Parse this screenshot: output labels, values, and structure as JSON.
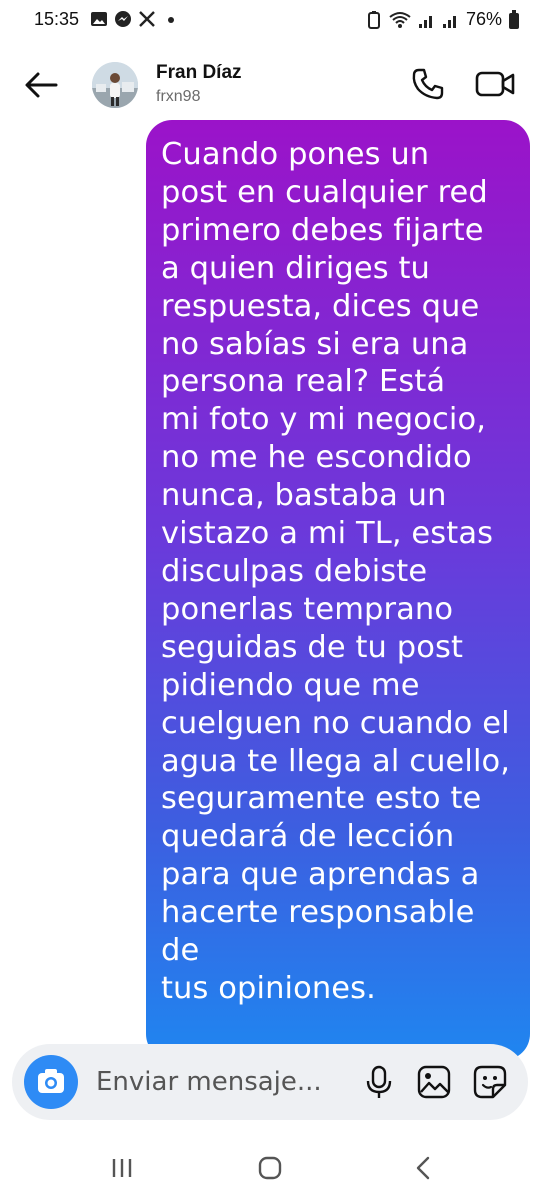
{
  "status_bar": {
    "time": "15:35",
    "battery": "76%",
    "left_icons": [
      "gallery-icon",
      "messenger-icon",
      "x-icon",
      "dot-icon"
    ],
    "right_icons": [
      "battery-saver-icon",
      "wifi-icon",
      "signal-icon",
      "signal-icon",
      "battery-icon"
    ]
  },
  "header": {
    "name": "Fran Díaz",
    "handle": "frxn98",
    "back_icon": "arrow-left-icon",
    "call_icon": "phone-icon",
    "video_icon": "video-camera-icon"
  },
  "message": {
    "text": "Cuando pones un\npost en cualquier red\nprimero debes fijarte\na quien diriges tu\nrespuesta, dices que\nno sabías si era una\npersona real? Está\nmi foto y mi negocio,\nno me he escondido\nnunca, bastaba un\nvistazo a mi TL, estas\ndisculpas debiste\nponerlas temprano\nseguidas de tu post\npidiendo que me\ncuelguen no cuando el\nagua te llega al cuello,\nseguramente esto te\nquedará de lección\npara que aprendas a\nhacerte responsable de\ntus opiniones.",
    "colors": {
      "top": "#9b13c9",
      "bottom": "#1f86f0"
    }
  },
  "composer": {
    "placeholder": "Enviar mensaje...",
    "camera_icon": "camera-icon",
    "mic_icon": "microphone-icon",
    "gallery_icon": "image-icon",
    "sticker_icon": "sticker-icon",
    "accent": "#2e8bf5"
  },
  "nav_bar": {
    "icons": [
      "recent-apps-icon",
      "home-icon",
      "back-icon"
    ]
  }
}
